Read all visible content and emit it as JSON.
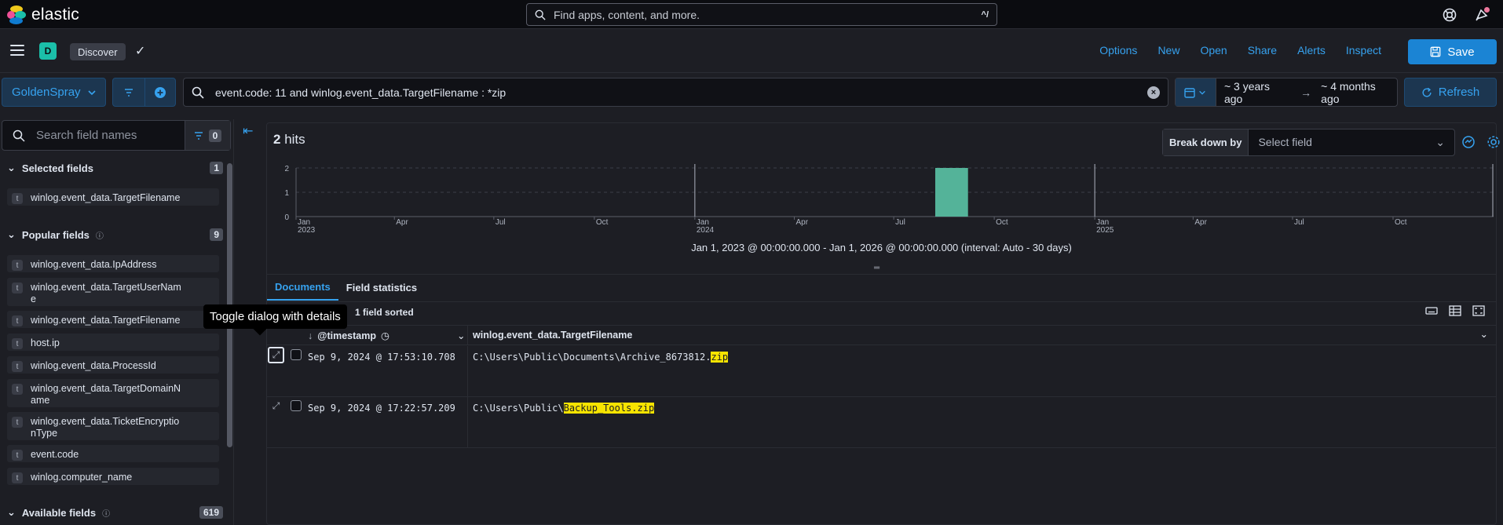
{
  "brand": "elastic",
  "global_search": {
    "placeholder": "Find apps, content, and more.",
    "shortcut": "^/"
  },
  "appbar": {
    "space_letter": "D",
    "breadcrumb": "Discover",
    "links": [
      "Options",
      "New",
      "Open",
      "Share",
      "Alerts",
      "Inspect"
    ],
    "save_label": "Save"
  },
  "querybar": {
    "data_view": "GoldenSpray",
    "query": "event.code: 11 and winlog.event_data.TargetFilename : *zip",
    "date_start": "~ 3 years ago",
    "date_end": "~ 4 months ago",
    "refresh_label": "Refresh"
  },
  "sidebar": {
    "search_placeholder": "Search field names",
    "filter_count": "0",
    "selected": {
      "title": "Selected fields",
      "count": "1",
      "items": [
        "winlog.event_data.TargetFilename"
      ]
    },
    "popular": {
      "title": "Popular fields",
      "count": "9",
      "items": [
        "winlog.event_data.IpAddress",
        "winlog.event_data.TargetUserNam\ne",
        "winlog.event_data.TargetFilename",
        "host.ip",
        "winlog.event_data.ProcessId",
        "winlog.event_data.TargetDomainN\name",
        "winlog.event_data.TicketEncryptio\nnType",
        "event.code",
        "winlog.computer_name"
      ]
    },
    "available": {
      "title": "Available fields",
      "count": "619"
    },
    "field_type": "t"
  },
  "main": {
    "hits_count": "2",
    "hits_label": "hits",
    "breakdown_label": "Break down by",
    "breakdown_placeholder": "Select field",
    "interval_text": "Jan 1, 2023 @ 00:00:00.000 - Jan 1, 2026 @ 00:00:00.000 (interval: Auto - 30 days)",
    "tabs": [
      "Documents",
      "Field statistics"
    ],
    "sorted_label": "1 field sorted",
    "columns": [
      "@timestamp",
      "winlog.event_data.TargetFilename"
    ],
    "rows": [
      {
        "timestamp": "Sep 9, 2024 @ 17:53:10.708",
        "file_prefix": "C:\\Users\\Public\\Documents\\Archive_8673812.",
        "file_match": "zip"
      },
      {
        "timestamp": "Sep 9, 2024 @ 17:22:57.209",
        "file_prefix": "C:\\Users\\Public\\",
        "file_match": "Backup_Tools.zip"
      }
    ],
    "tooltip": "Toggle dialog with details"
  },
  "chart_data": {
    "type": "bar",
    "x_ticks": [
      {
        "label": "Jan",
        "sub": "2023"
      },
      {
        "label": "Apr"
      },
      {
        "label": "Jul"
      },
      {
        "label": "Oct"
      },
      {
        "label": "Jan",
        "sub": "2024"
      },
      {
        "label": "Apr"
      },
      {
        "label": "Jul"
      },
      {
        "label": "Oct"
      },
      {
        "label": "Jan",
        "sub": "2025"
      },
      {
        "label": "Apr"
      },
      {
        "label": "Jul"
      },
      {
        "label": "Oct"
      }
    ],
    "y_ticks": [
      "0",
      "1",
      "2"
    ],
    "ylim": [
      0,
      2
    ],
    "bars": [
      {
        "start": "2024-08-08",
        "end": "2024-09-07",
        "value": 2
      }
    ],
    "xrange": [
      "2023-01-01",
      "2026-01-01"
    ],
    "bar_color": "#54b399"
  }
}
